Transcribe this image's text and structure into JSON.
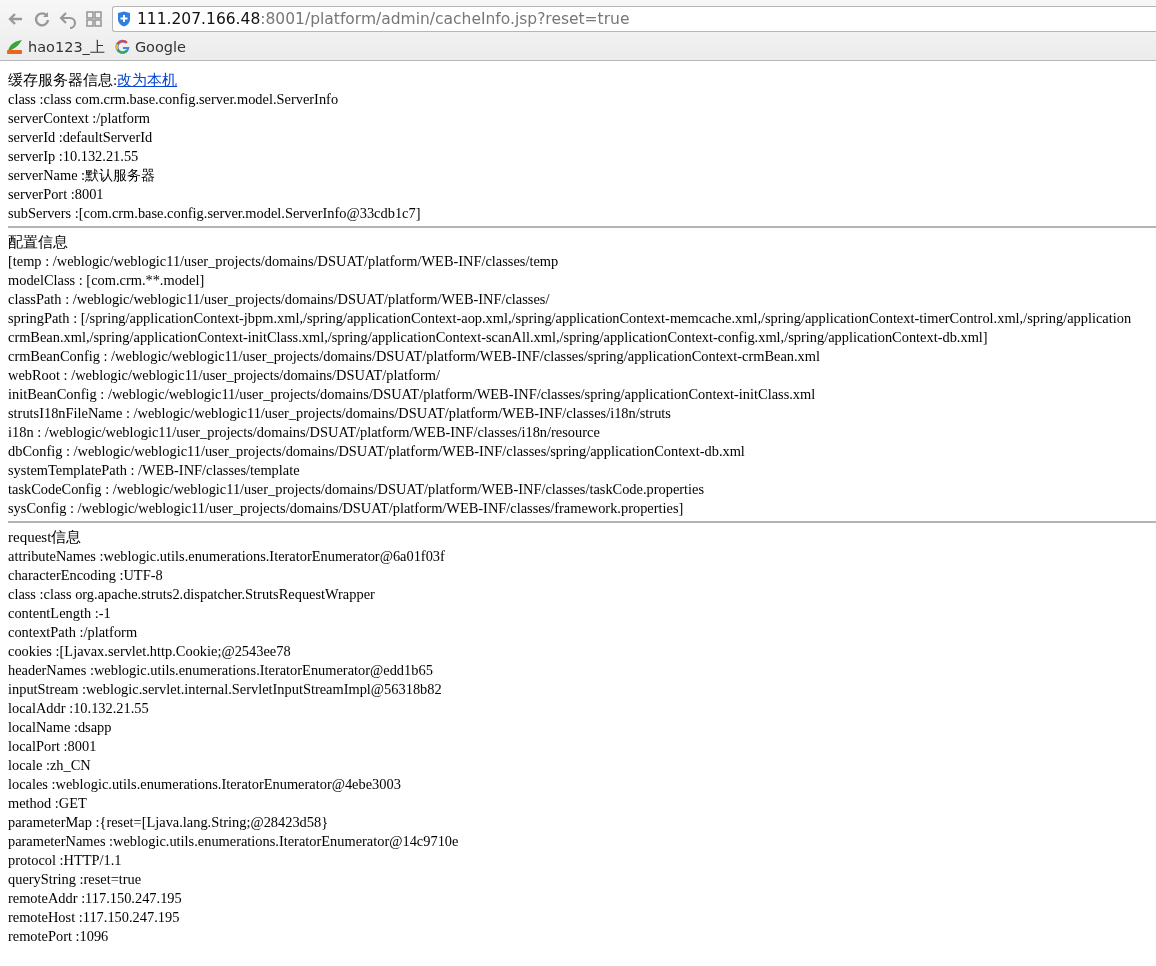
{
  "browser": {
    "url_host": "111.207.166.48",
    "url_rest": ":8001/platform/admin/cacheInfo.jsp?reset=true",
    "bookmarks": [
      {
        "label": "hao123_上",
        "kind": "hao"
      },
      {
        "label": "Google",
        "kind": "google"
      }
    ]
  },
  "sections": [
    {
      "heading": "缓存服务器信息:",
      "link": "改为本机",
      "lines": [
        "class :class com.crm.base.config.server.model.ServerInfo",
        "serverContext :/platform",
        "serverId :defaultServerId",
        "serverIp :10.132.21.55",
        "serverName :默认服务器",
        "serverPort :8001",
        "subServers :[com.crm.base.config.server.model.ServerInfo@33cdb1c7]"
      ]
    },
    {
      "heading": "配置信息",
      "lines": [
        "[temp : /weblogic/weblogic11/user_projects/domains/DSUAT/platform/WEB-INF/classes/temp",
        "modelClass : [com.crm.**.model]",
        "classPath : /weblogic/weblogic11/user_projects/domains/DSUAT/platform/WEB-INF/classes/",
        "springPath : [/spring/applicationContext-jbpm.xml,/spring/applicationContext-aop.xml,/spring/applicationContext-memcache.xml,/spring/applicationContext-timerControl.xml,/spring/application",
        "crmBean.xml,/spring/applicationContext-initClass.xml,/spring/applicationContext-scanAll.xml,/spring/applicationContext-config.xml,/spring/applicationContext-db.xml]",
        "crmBeanConfig : /weblogic/weblogic11/user_projects/domains/DSUAT/platform/WEB-INF/classes/spring/applicationContext-crmBean.xml",
        "webRoot : /weblogic/weblogic11/user_projects/domains/DSUAT/platform/",
        "initBeanConfig : /weblogic/weblogic11/user_projects/domains/DSUAT/platform/WEB-INF/classes/spring/applicationContext-initClass.xml",
        "strutsI18nFileName : /weblogic/weblogic11/user_projects/domains/DSUAT/platform/WEB-INF/classes/i18n/struts",
        "i18n : /weblogic/weblogic11/user_projects/domains/DSUAT/platform/WEB-INF/classes/i18n/resource",
        "dbConfig : /weblogic/weblogic11/user_projects/domains/DSUAT/platform/WEB-INF/classes/spring/applicationContext-db.xml",
        "systemTemplatePath : /WEB-INF/classes/template",
        "taskCodeConfig : /weblogic/weblogic11/user_projects/domains/DSUAT/platform/WEB-INF/classes/taskCode.properties",
        "sysConfig : /weblogic/weblogic11/user_projects/domains/DSUAT/platform/WEB-INF/classes/framework.properties]"
      ]
    },
    {
      "heading": "request信息",
      "lines": [
        "attributeNames :weblogic.utils.enumerations.IteratorEnumerator@6a01f03f",
        "characterEncoding :UTF-8",
        "class :class org.apache.struts2.dispatcher.StrutsRequestWrapper",
        "contentLength :-1",
        "contextPath :/platform",
        "cookies :[Ljavax.servlet.http.Cookie;@2543ee78",
        "headerNames :weblogic.utils.enumerations.IteratorEnumerator@edd1b65",
        "inputStream :weblogic.servlet.internal.ServletInputStreamImpl@56318b82",
        "localAddr :10.132.21.55",
        "localName :dsapp",
        "localPort :8001",
        "locale :zh_CN",
        "locales :weblogic.utils.enumerations.IteratorEnumerator@4ebe3003",
        "method :GET",
        "parameterMap :{reset=[Ljava.lang.String;@28423d58}",
        "parameterNames :weblogic.utils.enumerations.IteratorEnumerator@14c9710e",
        "protocol :HTTP/1.1",
        "queryString :reset=true",
        "remoteAddr :117.150.247.195",
        "remoteHost :117.150.247.195",
        "remotePort :1096"
      ]
    }
  ]
}
